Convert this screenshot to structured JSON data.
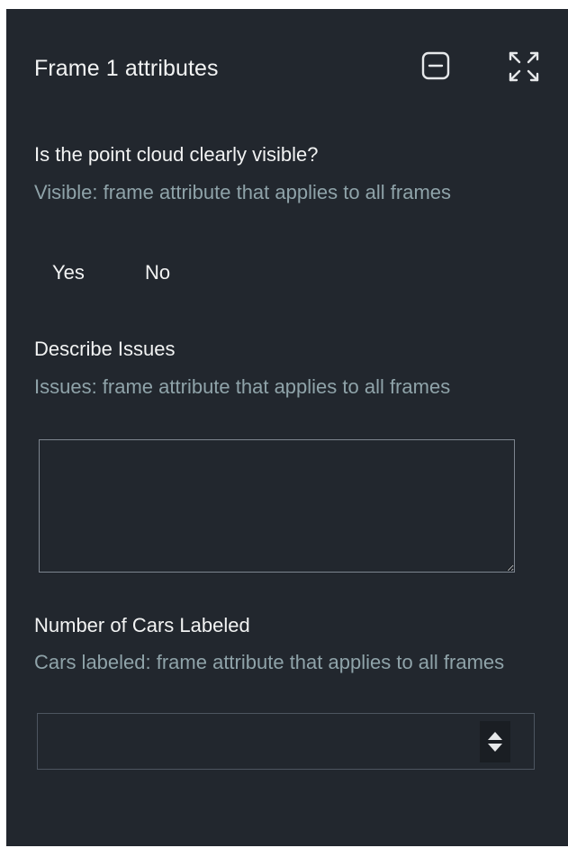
{
  "panel": {
    "title": "Frame 1 attributes",
    "minimize_icon": "minimize-square-icon",
    "expand_icon": "expand-arrows-icon"
  },
  "visibility_question": {
    "label": "Is the point cloud clearly visible?",
    "description": "Visible: frame attribute that applies to all frames",
    "options": [
      "Yes",
      "No"
    ]
  },
  "issues_question": {
    "label": "Describe Issues",
    "description": "Issues: frame attribute that applies to all frames",
    "value": "",
    "placeholder": ""
  },
  "cars_question": {
    "label": "Number of Cars Labeled",
    "description": "Cars labeled: frame attribute that applies to all frames",
    "value": "",
    "stepper_icon": "up-down-stepper-icon"
  },
  "colors": {
    "panel_bg": "#22272e",
    "label": "#f2f3f3",
    "description": "#8fa3a9",
    "border": "#7d858f"
  }
}
